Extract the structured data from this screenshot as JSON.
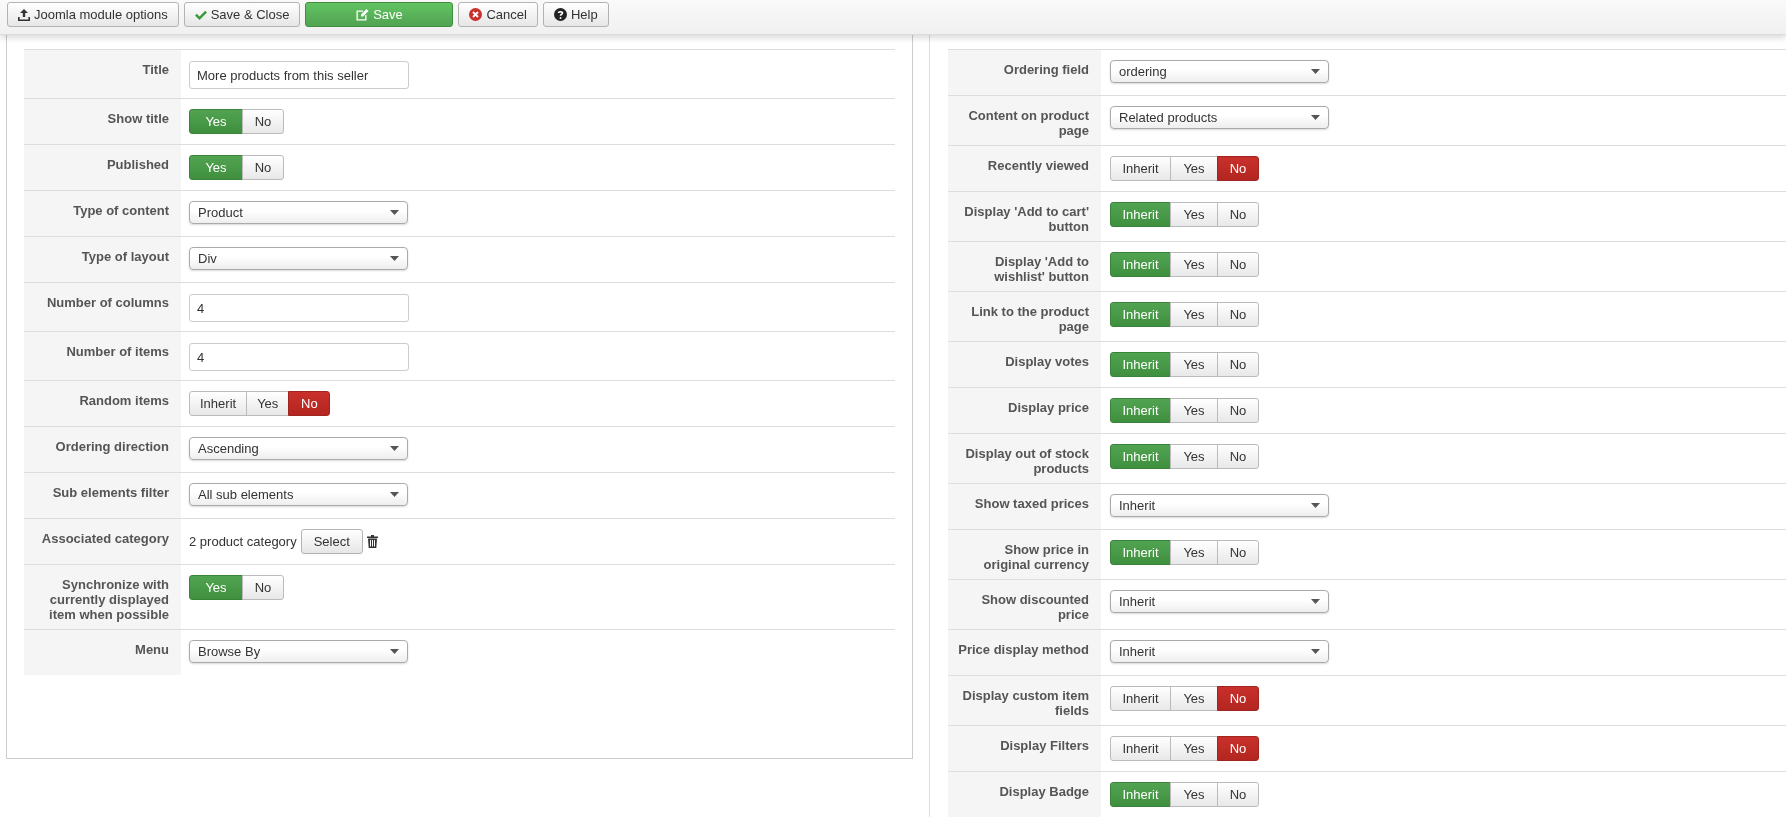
{
  "toolbar": [
    {
      "label": "Joomla module options",
      "kind": "options"
    },
    {
      "label": "Save & Close",
      "kind": "save-close"
    },
    {
      "label": "Save",
      "kind": "save"
    },
    {
      "label": "Cancel",
      "kind": "cancel"
    },
    {
      "label": "Help",
      "kind": "help"
    }
  ],
  "left_fields": [
    {
      "label": "Title",
      "kind": "text",
      "value": "More products from this seller"
    },
    {
      "label": "Show title",
      "kind": "toggle",
      "options": [
        {
          "label": "Yes",
          "selected": true
        },
        {
          "label": "No",
          "selected": false
        }
      ]
    },
    {
      "label": "Published",
      "kind": "toggle",
      "options": [
        {
          "label": "Yes",
          "selected": true
        },
        {
          "label": "No",
          "selected": false
        }
      ]
    },
    {
      "label": "Type of content",
      "kind": "select",
      "value": "Product"
    },
    {
      "label": "Type of layout",
      "kind": "select",
      "value": "Div"
    },
    {
      "label": "Number of columns",
      "kind": "text",
      "value": "4"
    },
    {
      "label": "Number of items",
      "kind": "text",
      "value": "4"
    },
    {
      "label": "Random items",
      "kind": "toggle",
      "options": [
        {
          "label": "Inherit",
          "selected": false
        },
        {
          "label": "Yes",
          "selected": false
        },
        {
          "label": "No",
          "selected": true
        }
      ]
    },
    {
      "label": "Ordering direction",
      "kind": "select",
      "value": "Ascending"
    },
    {
      "label": "Sub elements filter",
      "kind": "select",
      "value": "All sub elements"
    },
    {
      "label": "Associated category",
      "kind": "category",
      "value": "2 product category",
      "button": "Select"
    },
    {
      "label": "Synchronize with currently displayed item when possible",
      "kind": "toggle",
      "options": [
        {
          "label": "Yes",
          "selected": true
        },
        {
          "label": "No",
          "selected": false
        }
      ]
    },
    {
      "label": "Menu",
      "kind": "select",
      "value": "Browse By"
    }
  ],
  "right_fields": [
    {
      "label": "Ordering field",
      "kind": "select",
      "value": "ordering"
    },
    {
      "label": "Content on product page",
      "kind": "select",
      "value": "Related products"
    },
    {
      "label": "Recently viewed",
      "kind": "toggle",
      "options": [
        {
          "label": "Inherit",
          "selected": false
        },
        {
          "label": "Yes",
          "selected": false
        },
        {
          "label": "No",
          "selected": true
        }
      ]
    },
    {
      "label": "Display 'Add to cart' button",
      "kind": "toggle",
      "options": [
        {
          "label": "Inherit",
          "selected": true
        },
        {
          "label": "Yes",
          "selected": false
        },
        {
          "label": "No",
          "selected": false
        }
      ]
    },
    {
      "label": "Display 'Add to wishlist' button",
      "kind": "toggle",
      "options": [
        {
          "label": "Inherit",
          "selected": true
        },
        {
          "label": "Yes",
          "selected": false
        },
        {
          "label": "No",
          "selected": false
        }
      ]
    },
    {
      "label": "Link to the product page",
      "kind": "toggle",
      "options": [
        {
          "label": "Inherit",
          "selected": true
        },
        {
          "label": "Yes",
          "selected": false
        },
        {
          "label": "No",
          "selected": false
        }
      ]
    },
    {
      "label": "Display votes",
      "kind": "toggle",
      "options": [
        {
          "label": "Inherit",
          "selected": true
        },
        {
          "label": "Yes",
          "selected": false
        },
        {
          "label": "No",
          "selected": false
        }
      ]
    },
    {
      "label": "Display price",
      "kind": "toggle",
      "options": [
        {
          "label": "Inherit",
          "selected": true
        },
        {
          "label": "Yes",
          "selected": false
        },
        {
          "label": "No",
          "selected": false
        }
      ]
    },
    {
      "label": "Display out of stock products",
      "kind": "toggle",
      "options": [
        {
          "label": "Inherit",
          "selected": true
        },
        {
          "label": "Yes",
          "selected": false
        },
        {
          "label": "No",
          "selected": false
        }
      ]
    },
    {
      "label": "Show taxed prices",
      "kind": "select",
      "value": "Inherit"
    },
    {
      "label": "Show price in original currency",
      "kind": "toggle",
      "options": [
        {
          "label": "Inherit",
          "selected": true
        },
        {
          "label": "Yes",
          "selected": false
        },
        {
          "label": "No",
          "selected": false
        }
      ]
    },
    {
      "label": "Show discounted price",
      "kind": "select",
      "value": "Inherit"
    },
    {
      "label": "Price display method",
      "kind": "select",
      "value": "Inherit"
    },
    {
      "label": "Display custom item fields",
      "kind": "toggle",
      "options": [
        {
          "label": "Inherit",
          "selected": false
        },
        {
          "label": "Yes",
          "selected": false
        },
        {
          "label": "No",
          "selected": true
        }
      ]
    },
    {
      "label": "Display Filters",
      "kind": "toggle",
      "options": [
        {
          "label": "Inherit",
          "selected": false
        },
        {
          "label": "Yes",
          "selected": false
        },
        {
          "label": "No",
          "selected": true
        }
      ]
    },
    {
      "label": "Display Badge",
      "kind": "toggle",
      "options": [
        {
          "label": "Inherit",
          "selected": true
        },
        {
          "label": "Yes",
          "selected": false
        },
        {
          "label": "No",
          "selected": false
        }
      ]
    }
  ]
}
